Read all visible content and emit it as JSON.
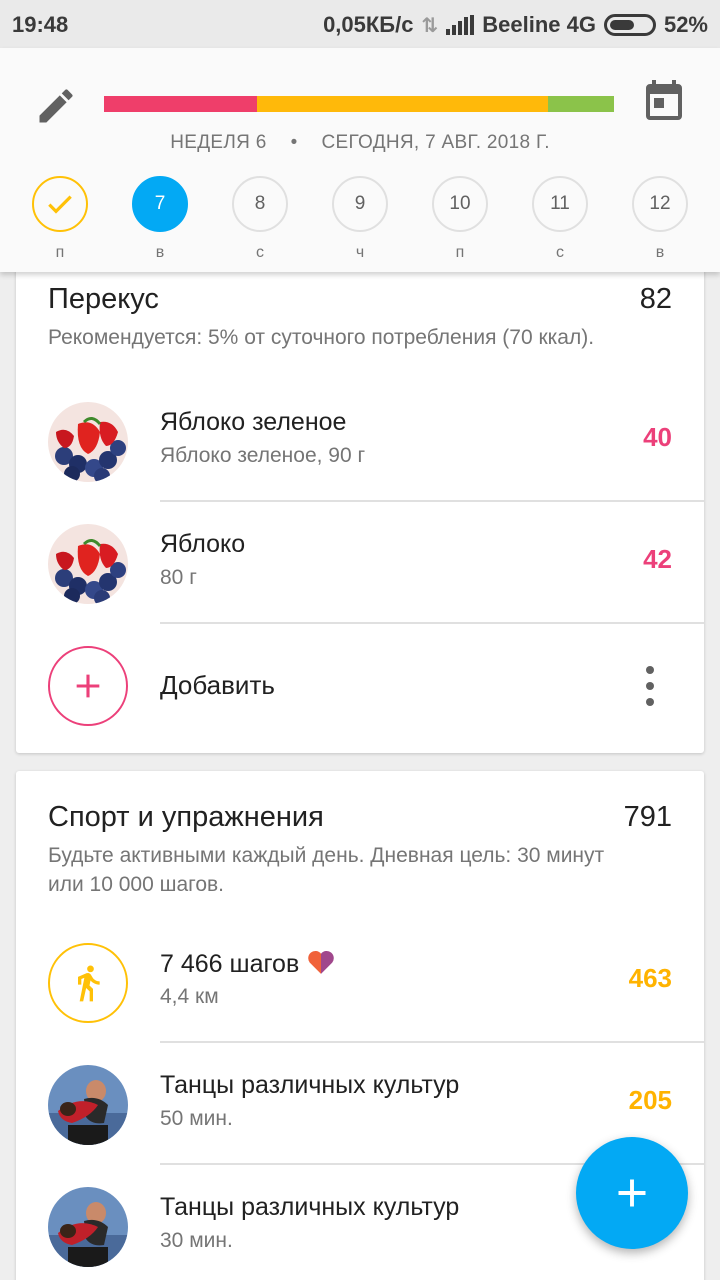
{
  "status_bar": {
    "time": "19:48",
    "speed": "0,05КБ/с",
    "carrier": "Beeline 4G",
    "battery": "52%"
  },
  "header": {
    "edit_icon": "pencil-icon",
    "calendar_icon": "calendar-icon",
    "week_label": "НЕДЕЛЯ 6",
    "separator": "•",
    "date_label": "СЕГОДНЯ, 7 АВГ. 2018 Г.",
    "progress_colors": [
      "#ef3e6a",
      "#ffb90a",
      "#8bc34a"
    ],
    "progress_fractions": [
      0.3,
      0.57,
      0.13
    ],
    "days": [
      {
        "num": "",
        "label": "п",
        "state": "done",
        "icon": "check-icon"
      },
      {
        "num": "7",
        "label": "в",
        "state": "active"
      },
      {
        "num": "8",
        "label": "с",
        "state": "upcoming"
      },
      {
        "num": "9",
        "label": "ч",
        "state": "upcoming"
      },
      {
        "num": "10",
        "label": "п",
        "state": "upcoming"
      },
      {
        "num": "11",
        "label": "с",
        "state": "upcoming"
      },
      {
        "num": "12",
        "label": "в",
        "state": "upcoming"
      }
    ]
  },
  "snack": {
    "title": "Перекус",
    "total": "82",
    "description": "Рекомендуется: 5% от суточного потребления (70 ккал).",
    "items": [
      {
        "name": "Яблоко зеленое",
        "sub": "Яблоко зеленое, 90 г",
        "kcal": "40"
      },
      {
        "name": "Яблоко",
        "sub": "80 г",
        "kcal": "42"
      }
    ],
    "add_label": "Добавить"
  },
  "sport": {
    "title": "Спорт и упражнения",
    "total": "791",
    "description": "Будьте активными каждый день. Дневная цель: 30 минут или 10 000 шагов.",
    "items": [
      {
        "name": "7 466 шагов",
        "sub": "4,4 км",
        "kcal": "463"
      },
      {
        "name": "Танцы различных культур",
        "sub": "50 мин.",
        "kcal": "205"
      },
      {
        "name": "Танцы различных культур",
        "sub": "30 мин.",
        "kcal": ""
      }
    ]
  },
  "colors": {
    "accent_blue": "#03a9f4",
    "pink": "#ec407a",
    "amber": "#ffb300"
  }
}
